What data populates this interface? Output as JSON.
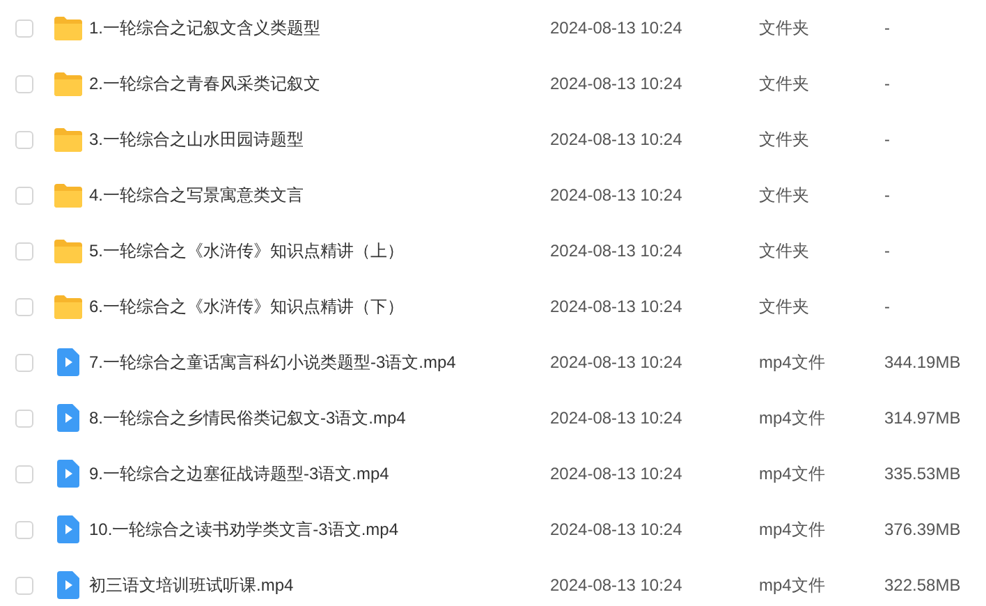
{
  "files": [
    {
      "kind": "folder",
      "checked": false,
      "name": "1.一轮综合之记叙文含义类题型",
      "modified": "2024-08-13 10:24",
      "type": "文件夹",
      "size": "-"
    },
    {
      "kind": "folder",
      "checked": false,
      "name": "2.一轮综合之青春风采类记叙文",
      "modified": "2024-08-13 10:24",
      "type": "文件夹",
      "size": "-"
    },
    {
      "kind": "folder",
      "checked": false,
      "name": "3.一轮综合之山水田园诗题型",
      "modified": "2024-08-13 10:24",
      "type": "文件夹",
      "size": "-"
    },
    {
      "kind": "folder",
      "checked": false,
      "name": "4.一轮综合之写景寓意类文言",
      "modified": "2024-08-13 10:24",
      "type": "文件夹",
      "size": "-"
    },
    {
      "kind": "folder",
      "checked": false,
      "name": "5.一轮综合之《水浒传》知识点精讲（上）",
      "modified": "2024-08-13 10:24",
      "type": "文件夹",
      "size": "-"
    },
    {
      "kind": "folder",
      "checked": false,
      "name": "6.一轮综合之《水浒传》知识点精讲（下）",
      "modified": "2024-08-13 10:24",
      "type": "文件夹",
      "size": "-"
    },
    {
      "kind": "video",
      "checked": false,
      "name": "7.一轮综合之童话寓言科幻小说类题型-3语文.mp4",
      "modified": "2024-08-13 10:24",
      "type": "mp4文件",
      "size": "344.19MB"
    },
    {
      "kind": "video",
      "checked": false,
      "name": "8.一轮综合之乡情民俗类记叙文-3语文.mp4",
      "modified": "2024-08-13 10:24",
      "type": "mp4文件",
      "size": "314.97MB"
    },
    {
      "kind": "video",
      "checked": false,
      "name": "9.一轮综合之边塞征战诗题型-3语文.mp4",
      "modified": "2024-08-13 10:24",
      "type": "mp4文件",
      "size": "335.53MB"
    },
    {
      "kind": "video",
      "checked": false,
      "name": "10.一轮综合之读书劝学类文言-3语文.mp4",
      "modified": "2024-08-13 10:24",
      "type": "mp4文件",
      "size": "376.39MB"
    },
    {
      "kind": "video",
      "checked": false,
      "name": "初三语文培训班试听课.mp4",
      "modified": "2024-08-13 10:24",
      "type": "mp4文件",
      "size": "322.58MB"
    }
  ]
}
